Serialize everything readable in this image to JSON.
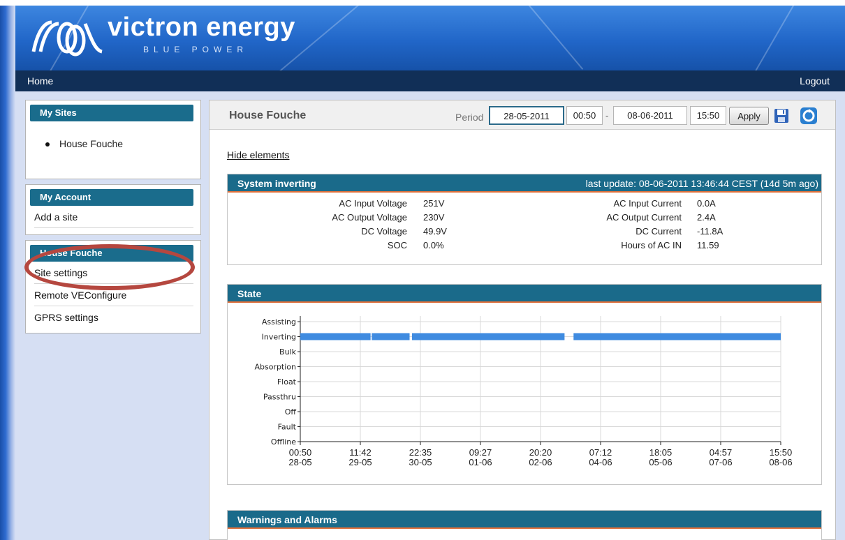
{
  "brand": {
    "name": "victron energy",
    "tagline": "BLUE POWER"
  },
  "nav": {
    "home": "Home",
    "logout": "Logout"
  },
  "sidebar": {
    "my_sites": {
      "title": "My Sites",
      "items": [
        "House Fouche"
      ]
    },
    "my_account": {
      "title": "My Account",
      "items": [
        "Add a site"
      ]
    },
    "site_menu": {
      "title": "House Fouche",
      "items": [
        "Site settings",
        "Remote VEConfigure",
        "GPRS settings"
      ]
    }
  },
  "main": {
    "title": "House Fouche",
    "period_label": "Period",
    "date_from": "28-05-2011",
    "time_from": "00:50",
    "dash": "-",
    "date_to": "08-06-2011",
    "time_to": "15:50",
    "apply": "Apply",
    "hide_elements": "Hide elements"
  },
  "system": {
    "title": "System inverting",
    "last_update": "last update: 08-06-2011 13:46:44 CEST (14d 5m ago)",
    "left": [
      {
        "label": "AC Input Voltage",
        "value": "251V"
      },
      {
        "label": "AC Output Voltage",
        "value": "230V"
      },
      {
        "label": "DC Voltage",
        "value": "49.9V"
      },
      {
        "label": "SOC",
        "value": "0.0%"
      }
    ],
    "right": [
      {
        "label": "AC Input Current",
        "value": "0.0A"
      },
      {
        "label": "AC Output Current",
        "value": "2.4A"
      },
      {
        "label": "DC Current",
        "value": "-11.8A"
      },
      {
        "label": "Hours of AC IN",
        "value": "11.59"
      }
    ]
  },
  "state": {
    "title": "State"
  },
  "warnings": {
    "title": "Warnings and Alarms"
  },
  "colors": {
    "section_header": "#1a6a8a",
    "accent_line": "#e0703a",
    "series": "#3f8be0",
    "highlight": "#b5473f"
  },
  "chart_data": {
    "type": "timeline",
    "categories": [
      "Assisting",
      "Inverting",
      "Bulk",
      "Absorption",
      "Float",
      "Passthru",
      "Off",
      "Fault",
      "Offline"
    ],
    "x_ticks": [
      {
        "time": "00:50",
        "date": "28-05"
      },
      {
        "time": "11:42",
        "date": "29-05"
      },
      {
        "time": "22:35",
        "date": "30-05"
      },
      {
        "time": "09:27",
        "date": "01-06"
      },
      {
        "time": "20:20",
        "date": "02-06"
      },
      {
        "time": "07:12",
        "date": "04-06"
      },
      {
        "time": "18:05",
        "date": "05-06"
      },
      {
        "time": "04:57",
        "date": "07-06"
      },
      {
        "time": "15:50",
        "date": "08-06"
      }
    ],
    "series": [
      {
        "state": "Inverting",
        "segments": [
          {
            "from": 0.0,
            "to": 1.17
          },
          {
            "from": 1.19,
            "to": 1.82
          },
          {
            "from": 1.86,
            "to": 4.4
          },
          {
            "from": 4.55,
            "to": 8.0
          }
        ]
      }
    ],
    "x_units": "tick index (0 = 28-05 00:50, 8 = 08-06 15:50)",
    "grid": true
  }
}
